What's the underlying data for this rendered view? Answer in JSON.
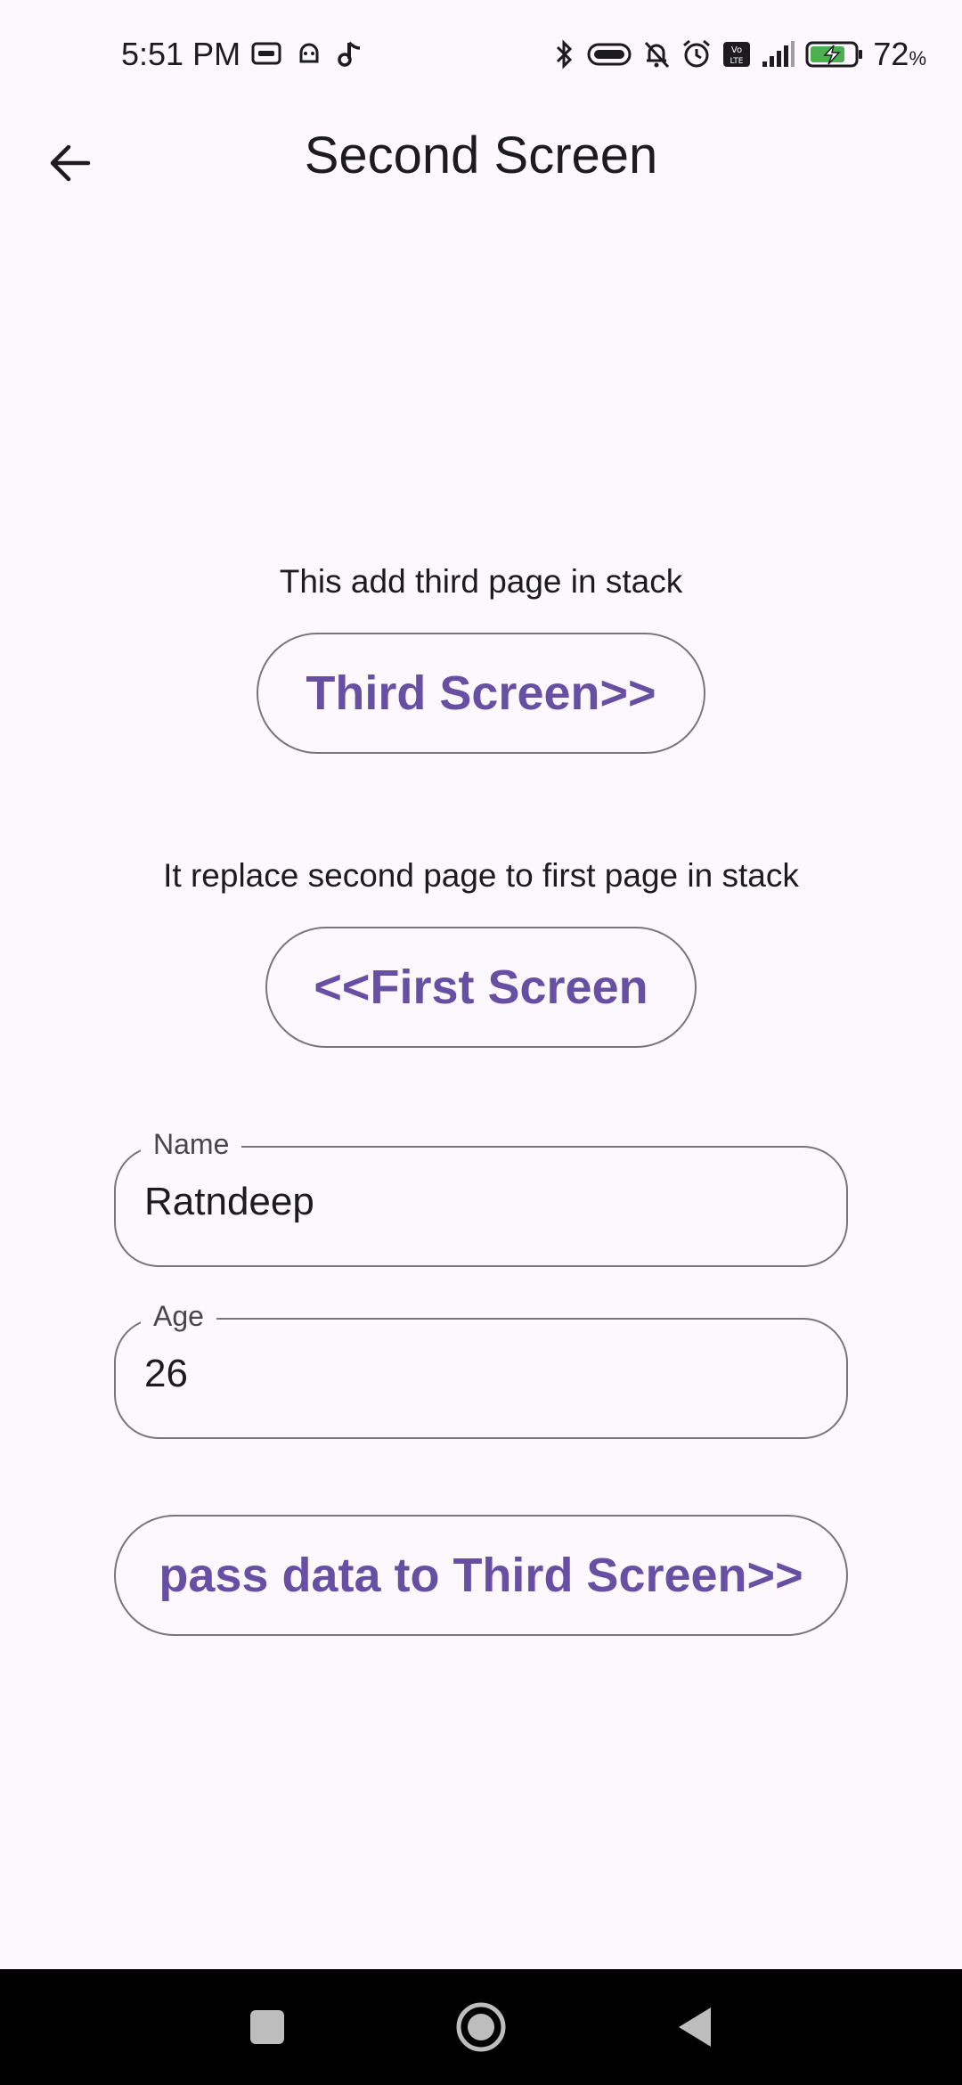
{
  "status_bar": {
    "time": "5:51 PM",
    "battery_percent": "72",
    "battery_unit": "%",
    "icons_left": [
      "screen-record-icon",
      "android-robot-icon",
      "music-note-icon"
    ],
    "icons_right": [
      "bluetooth-icon",
      "vibrate-icon",
      "bell-off-icon",
      "alarm-icon",
      "volte-icon",
      "signal-icon",
      "battery-charging-icon"
    ]
  },
  "app_bar": {
    "title": "Second Screen",
    "back_icon": "arrow-back-icon"
  },
  "main": {
    "third_caption": "This add third page in stack",
    "third_button": "Third Screen>>",
    "first_caption": "It replace second page to first page in stack",
    "first_button": "<<First Screen",
    "name_field": {
      "label": "Name",
      "value": "Ratndeep"
    },
    "age_field": {
      "label": "Age",
      "value": "26"
    },
    "pass_button": "pass data to Third Screen>>"
  },
  "nav_bar": {
    "items": [
      "recents-icon",
      "home-icon",
      "back-icon"
    ]
  },
  "colors": {
    "accent": "#6750a4",
    "outline": "#79747e",
    "background": "#fdf8fd",
    "battery_green": "#4caf50"
  }
}
